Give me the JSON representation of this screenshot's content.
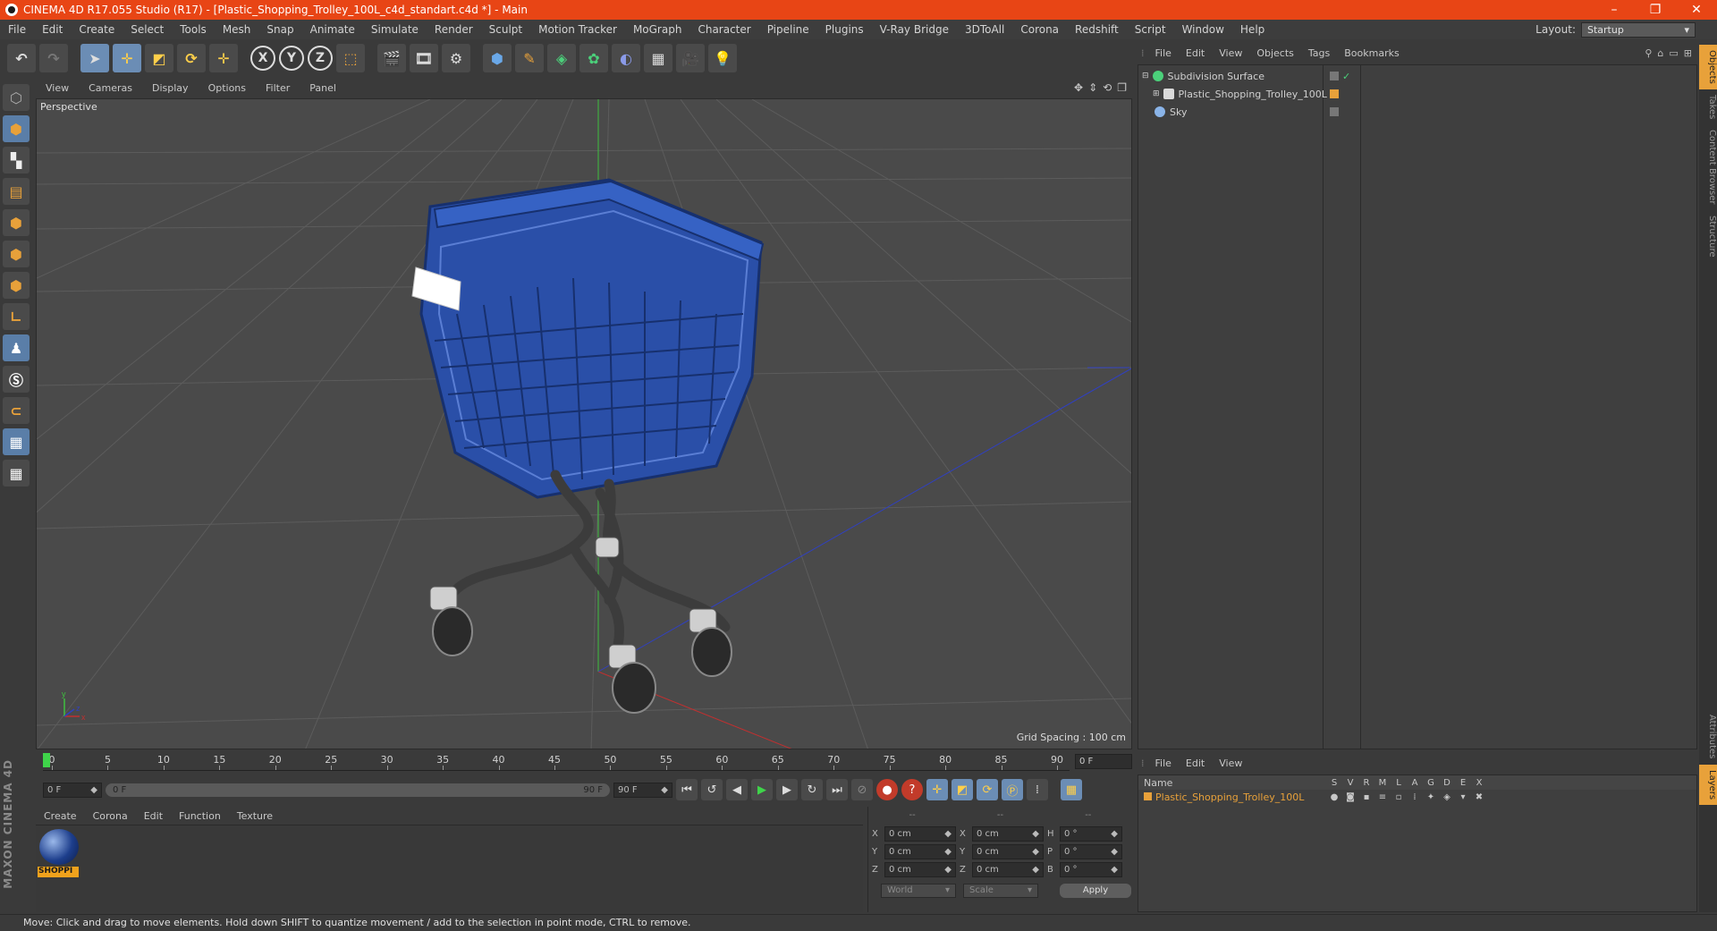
{
  "window": {
    "title": "CINEMA 4D R17.055 Studio (R17) - [Plastic_Shopping_Trolley_100L_c4d_standart.c4d *] - Main",
    "controls": [
      "–",
      "❐",
      "✕"
    ]
  },
  "menu": {
    "items": [
      "File",
      "Edit",
      "Create",
      "Select",
      "Tools",
      "Mesh",
      "Snap",
      "Animate",
      "Simulate",
      "Render",
      "Sculpt",
      "Motion Tracker",
      "MoGraph",
      "Character",
      "Pipeline",
      "Plugins",
      "V-Ray Bridge",
      "3DToAll",
      "Corona",
      "Redshift",
      "Script",
      "Window",
      "Help"
    ],
    "layout_label": "Layout:",
    "layout_value": "Startup"
  },
  "toolbar": {
    "axis_x": "X",
    "axis_y": "Y",
    "axis_z": "Z"
  },
  "viewport": {
    "menu": [
      "View",
      "Cameras",
      "Display",
      "Options",
      "Filter",
      "Panel"
    ],
    "label": "Perspective",
    "grid_spacing": "Grid Spacing : 100 cm"
  },
  "timeline": {
    "ticks": [
      "0",
      "5",
      "10",
      "15",
      "20",
      "25",
      "30",
      "35",
      "40",
      "45",
      "50",
      "55",
      "60",
      "65",
      "70",
      "75",
      "80",
      "85",
      "90"
    ],
    "current_frame": "0 F"
  },
  "transport": {
    "start_field": "0 F",
    "range_start": "0 F",
    "range_end": "90 F",
    "end_field": "90 F"
  },
  "materials": {
    "menu": [
      "Create",
      "Corona",
      "Edit",
      "Function",
      "Texture"
    ],
    "items": [
      {
        "label": "SHOPPI"
      }
    ]
  },
  "coordinates": {
    "headers": [
      "--",
      "--",
      "--"
    ],
    "rows": [
      {
        "a": "X",
        "av": "0 cm",
        "b": "X",
        "bv": "0 cm",
        "c": "H",
        "cv": "0 °"
      },
      {
        "a": "Y",
        "av": "0 cm",
        "b": "Y",
        "bv": "0 cm",
        "c": "P",
        "cv": "0 °"
      },
      {
        "a": "Z",
        "av": "0 cm",
        "b": "Z",
        "bv": "0 cm",
        "c": "B",
        "cv": "0 °"
      }
    ],
    "mode1": "World",
    "mode2": "Scale",
    "apply": "Apply"
  },
  "status": "Move: Click and drag to move elements. Hold down SHIFT to quantize movement / add to the selection in point mode, CTRL to remove.",
  "objects": {
    "menu": [
      "File",
      "Edit",
      "View",
      "Objects",
      "Tags",
      "Bookmarks"
    ],
    "rows": [
      {
        "name": "Subdivision Surface",
        "color": "#4bd07a"
      },
      {
        "name": "Plastic_Shopping_Trolley_100L",
        "color": "#d9d9d9"
      },
      {
        "name": "Sky",
        "color": "#8ab4e8"
      }
    ]
  },
  "right_tabs": [
    "Objects",
    "Takes",
    "Content Browser",
    "Structure",
    "Attributes",
    "Layers"
  ],
  "layers": {
    "menu": [
      "File",
      "Edit",
      "View"
    ],
    "name_header": "Name",
    "flags": [
      "S",
      "V",
      "R",
      "M",
      "L",
      "A",
      "G",
      "D",
      "E",
      "X"
    ],
    "rows": [
      {
        "name": "Plastic_Shopping_Trolley_100L",
        "color": "#e8a13a"
      }
    ]
  },
  "accent_color": "#e8a13a",
  "title_color": "#e84515"
}
